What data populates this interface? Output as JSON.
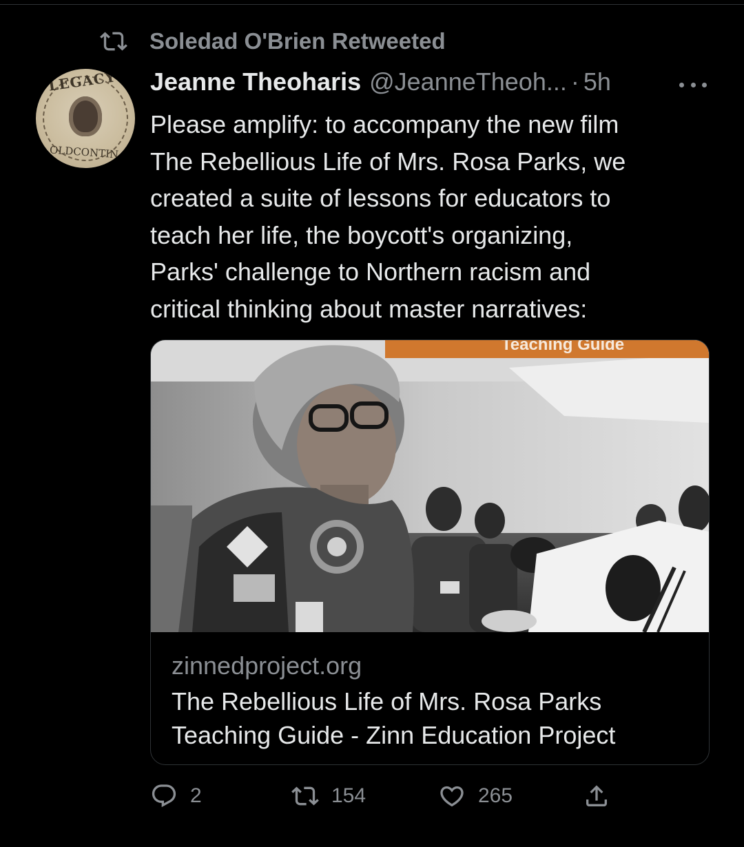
{
  "retweet": {
    "label": "Soledad O'Brien Retweeted",
    "icon": "retweet-icon"
  },
  "author": {
    "name": "Jeanne Theoharis",
    "handle": "@JeanneTheoh...",
    "separator": "·",
    "time": "5h",
    "avatar_stamp_top": "LEGACY",
    "avatar_stamp_bottom": "OLDCONTIN"
  },
  "tweet": {
    "lines": [
      "Please amplify: to accompany the new film",
      "The Rebellious Life of Mrs. Rosa Parks, we",
      "created a suite of lessons for educators to",
      "teach her life, the boycott's organizing,",
      "Parks' challenge to Northern racism and",
      "critical thinking about master narratives:"
    ]
  },
  "card": {
    "banner": "Teaching Guide",
    "domain": "zinnedproject.org",
    "title_line1": "The Rebellious Life of Mrs. Rosa Parks",
    "title_line2": "Teaching Guide - Zinn Education Project"
  },
  "actions": {
    "replies": "2",
    "retweets": "154",
    "likes": "265"
  },
  "colors": {
    "background": "#000000",
    "text": "#e7e9ea",
    "muted": "#8b8f94",
    "border": "#2f3336",
    "banner": "#d0782e"
  }
}
